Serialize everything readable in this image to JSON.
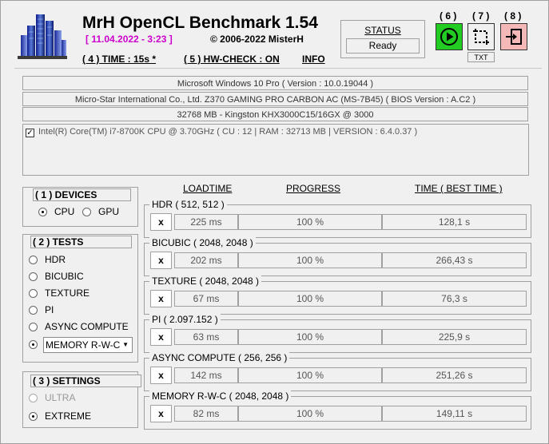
{
  "header": {
    "title": "MrH OpenCL Benchmark 1.54",
    "date": "[ 11.04.2022 - 3:23 ]",
    "copyright": "©  2006-2022 MisterH",
    "time_link": "( 4 ) TIME : 15s *",
    "hwcheck_link": "( 5 ) HW-CHECK : ON",
    "info_link": "INFO"
  },
  "status": {
    "label": "STATUS",
    "value": "Ready"
  },
  "toolbar": {
    "run_num": "( 6 )",
    "capture_num": "( 7 )",
    "exit_num": "( 8 )",
    "txt_label": "TXT",
    "colors": {
      "run": "#22cc22",
      "capture": "#f0f0f0",
      "exit": "#f4b8b8"
    }
  },
  "system": {
    "os": "Microsoft Windows 10 Pro ( Version : 10.0.19044 )",
    "board": "Micro-Star International Co., Ltd. Z370 GAMING PRO CARBON AC (MS-7B45) ( BIOS Version : A.C2 )",
    "memory": "32768 MB - Kingston KHX3000C15/16GX      @ 3000",
    "cpu_device": "Intel(R) Core(TM) i7-8700K CPU @ 3.70GHz ( CU : 12 | RAM : 32713 MB | VERSION : 6.4.0.37 )"
  },
  "devices": {
    "title": "( 1 ) DEVICES",
    "options": [
      {
        "label": "CPU",
        "selected": true
      },
      {
        "label": "GPU",
        "selected": false
      }
    ]
  },
  "tests": {
    "title": "( 2 ) TESTS",
    "options": [
      {
        "label": "HDR",
        "selected": false
      },
      {
        "label": "BICUBIC",
        "selected": false
      },
      {
        "label": "TEXTURE",
        "selected": false
      },
      {
        "label": "PI",
        "selected": false
      },
      {
        "label": "ASYNC COMPUTE",
        "selected": false
      },
      {
        "label": "MEMORY R-W-C",
        "selected": true
      }
    ]
  },
  "settings": {
    "title": "( 3 ) SETTINGS",
    "options": [
      {
        "label": "ULTRA",
        "selected": false
      },
      {
        "label": "EXTREME",
        "selected": true
      }
    ]
  },
  "results": {
    "col_loadtime": "LOADTIME",
    "col_progress": "PROGRESS",
    "col_time": "TIME ( BEST TIME )",
    "x_label": "x",
    "rows": [
      {
        "label": "HDR ( 512, 512 )",
        "load": "225 ms",
        "progress": "100 %",
        "time": "128,1 s"
      },
      {
        "label": "BICUBIC ( 2048, 2048 )",
        "load": "202 ms",
        "progress": "100 %",
        "time": "266,43 s"
      },
      {
        "label": "TEXTURE ( 2048, 2048 )",
        "load": "67 ms",
        "progress": "100 %",
        "time": "76,3 s"
      },
      {
        "label": "PI ( 2.097.152 )",
        "load": "63 ms",
        "progress": "100 %",
        "time": "225,9 s"
      },
      {
        "label": "ASYNC COMPUTE ( 256, 256 )",
        "load": "142 ms",
        "progress": "100 %",
        "time": "251,26 s"
      },
      {
        "label": "MEMORY R-W-C ( 2048, 2048 )",
        "load": "82 ms",
        "progress": "100 %",
        "time": "149,11 s"
      }
    ]
  }
}
